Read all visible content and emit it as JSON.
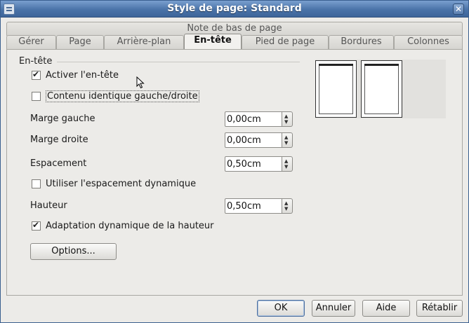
{
  "window": {
    "title": "Style de page: Standard"
  },
  "tabs_back": [
    {
      "label": "Note de bas de page"
    }
  ],
  "tabs_front": [
    {
      "label": "Gérer"
    },
    {
      "label": "Page"
    },
    {
      "label": "Arrière-plan"
    },
    {
      "label": "En-tête"
    },
    {
      "label": "Pied de page"
    },
    {
      "label": "Bordures"
    },
    {
      "label": "Colonnes"
    }
  ],
  "active_tab": "En-tête",
  "header_group": {
    "title": "En-tête",
    "activate_header": {
      "label": "Activer l'en-tête",
      "checked": true
    },
    "same_content": {
      "label": "Contenu identique gauche/droite",
      "checked": false
    },
    "left_margin": {
      "label": "Marge gauche",
      "value": "0,00cm"
    },
    "right_margin": {
      "label": "Marge droite",
      "value": "0,00cm"
    },
    "spacing": {
      "label": "Espacement",
      "value": "0,50cm"
    },
    "dynamic_spacing": {
      "label": "Utiliser l'espacement dynamique",
      "checked": false
    },
    "height": {
      "label": "Hauteur",
      "value": "0,50cm"
    },
    "autofit_height": {
      "label": "Adaptation dynamique de la hauteur",
      "checked": true
    },
    "options_button": "Options..."
  },
  "buttons": {
    "ok": "OK",
    "cancel": "Annuler",
    "help": "Aide",
    "reset": "Rétablir"
  },
  "icons": {
    "title_icon": "document-icon",
    "close": "close-icon",
    "spin_up": "chevron-up-icon",
    "spin_down": "chevron-down-icon",
    "cursor": "mouse-pointer-icon"
  }
}
